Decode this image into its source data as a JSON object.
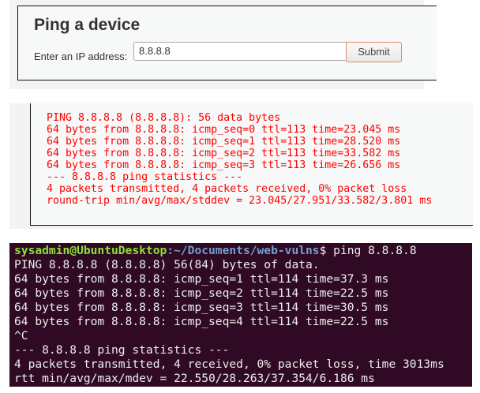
{
  "form": {
    "title": "Ping a device",
    "label": "Enter an IP address:",
    "ip_value": "8.8.8.8",
    "submit_label": "Submit"
  },
  "web_output": {
    "color": "#ff0000",
    "lines": [
      "PING 8.8.8.8 (8.8.8.8): 56 data bytes",
      "64 bytes from 8.8.8.8: icmp_seq=0 ttl=113 time=23.045 ms",
      "64 bytes from 8.8.8.8: icmp_seq=1 ttl=113 time=28.520 ms",
      "64 bytes from 8.8.8.8: icmp_seq=2 ttl=113 time=33.582 ms",
      "64 bytes from 8.8.8.8: icmp_seq=3 ttl=113 time=26.656 ms",
      "--- 8.8.8.8 ping statistics ---",
      "4 packets transmitted, 4 packets received, 0% packet loss",
      "round-trip min/avg/max/stddev = 23.045/27.951/33.582/3.801 ms"
    ]
  },
  "terminal": {
    "background": "#300a24",
    "user_host": "sysadmin@UbuntuDesktop",
    "path": ":~/Documents/web-vulns",
    "command": "$ ping 8.8.8.8",
    "lines": [
      "PING 8.8.8.8 (8.8.8.8) 56(84) bytes of data.",
      "64 bytes from 8.8.8.8: icmp_seq=1 ttl=114 time=37.3 ms",
      "64 bytes from 8.8.8.8: icmp_seq=2 ttl=114 time=22.5 ms",
      "64 bytes from 8.8.8.8: icmp_seq=3 ttl=114 time=30.5 ms",
      "64 bytes from 8.8.8.8: icmp_seq=4 ttl=114 time=22.5 ms",
      "^C",
      "--- 8.8.8.8 ping statistics ---",
      "4 packets transmitted, 4 received, 0% packet loss, time 3013ms",
      "rtt min/avg/max/mdev = 22.550/28.263/37.354/6.186 ms"
    ]
  }
}
